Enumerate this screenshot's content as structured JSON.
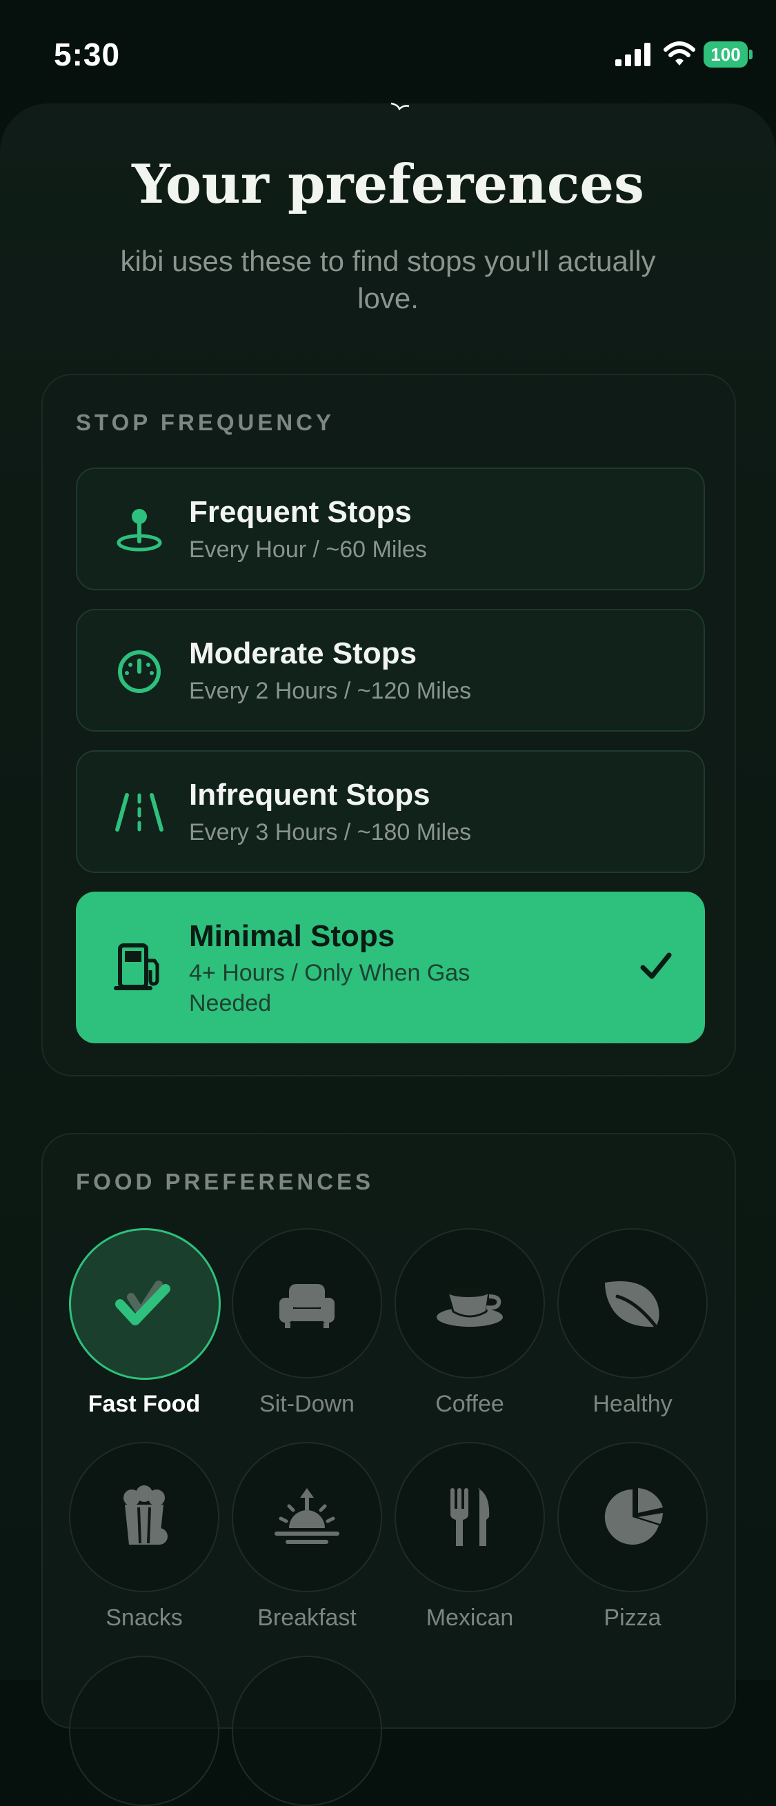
{
  "status_bar": {
    "time": "5:30",
    "battery": "100"
  },
  "header": {
    "title": "Your preferences",
    "subtitle": "kibi uses these to find stops you'll actually love."
  },
  "stop_frequency": {
    "label": "STOP FREQUENCY",
    "options": [
      {
        "name": "Frequent Stops",
        "desc": "Every Hour / ~60 Miles",
        "icon": "map-pin-icon",
        "selected": false
      },
      {
        "name": "Moderate Stops",
        "desc": "Every 2 Hours / ~120 Miles",
        "icon": "gauge-icon",
        "selected": false
      },
      {
        "name": "Infrequent Stops",
        "desc": "Every 3 Hours / ~180 Miles",
        "icon": "road-icon",
        "selected": false
      },
      {
        "name": "Minimal Stops",
        "desc": "4+ Hours / Only When Gas Needed",
        "icon": "gas-pump-icon",
        "selected": true
      }
    ]
  },
  "food_preferences": {
    "label": "FOOD PREFERENCES",
    "items": [
      {
        "label": "Fast Food",
        "icon": "check-icon",
        "selected": true
      },
      {
        "label": "Sit-Down",
        "icon": "armchair-icon",
        "selected": false
      },
      {
        "label": "Coffee",
        "icon": "coffee-cup-icon",
        "selected": false
      },
      {
        "label": "Healthy",
        "icon": "leaf-icon",
        "selected": false
      },
      {
        "label": "Snacks",
        "icon": "popcorn-icon",
        "selected": false
      },
      {
        "label": "Breakfast",
        "icon": "sunrise-icon",
        "selected": false
      },
      {
        "label": "Mexican",
        "icon": "fork-knife-icon",
        "selected": false
      },
      {
        "label": "Pizza",
        "icon": "pie-icon",
        "selected": false
      }
    ]
  },
  "colors": {
    "accent": "#2ec07d",
    "background": "#0a1611",
    "muted_text": "#8a948f"
  }
}
